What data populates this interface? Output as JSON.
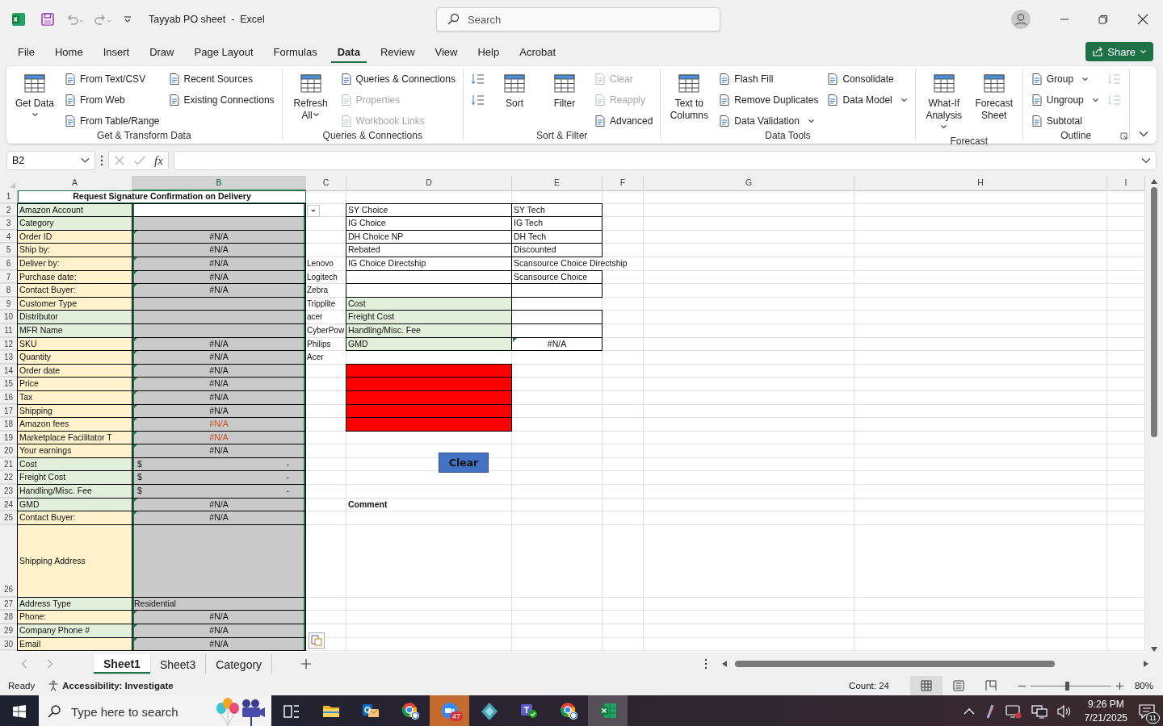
{
  "window": {
    "title": "Tayyab PO sheet  -  Excel",
    "search": {
      "placeholder": "Search"
    }
  },
  "menu": {
    "tabs": [
      {
        "label": "File",
        "selected": false
      },
      {
        "label": "Home",
        "selected": false
      },
      {
        "label": "Insert",
        "selected": false
      },
      {
        "label": "Draw",
        "selected": false
      },
      {
        "label": "Page Layout",
        "selected": false
      },
      {
        "label": "Formulas",
        "selected": false
      },
      {
        "label": "Data",
        "selected": true
      },
      {
        "label": "Review",
        "selected": false
      },
      {
        "label": "View",
        "selected": false
      },
      {
        "label": "Help",
        "selected": false
      },
      {
        "label": "Acrobat",
        "selected": false
      }
    ],
    "share": "Share"
  },
  "ribbon": {
    "groups": [
      {
        "label": "Get & Transform Data",
        "launcher": false,
        "items": [
          {
            "kind": "large",
            "label": "Get Data",
            "dropdown": true,
            "disabled": false
          },
          {
            "kind": "small",
            "label": "From Text/CSV",
            "dropdown": false,
            "disabled": false
          },
          {
            "kind": "small",
            "label": "From Web",
            "dropdown": false,
            "disabled": false
          },
          {
            "kind": "small",
            "label": "From Table/Range",
            "dropdown": false,
            "disabled": false
          },
          {
            "kind": "small",
            "label": "Recent Sources",
            "dropdown": false,
            "disabled": false
          },
          {
            "kind": "small",
            "label": "Existing Connections",
            "dropdown": false,
            "disabled": false
          }
        ]
      },
      {
        "label": "Queries & Connections",
        "launcher": false,
        "items": [
          {
            "kind": "large",
            "label": "Refresh All",
            "dropdown": true,
            "disabled": false
          },
          {
            "kind": "small",
            "label": "Queries & Connections",
            "dropdown": false,
            "disabled": false
          },
          {
            "kind": "small",
            "label": "Properties",
            "dropdown": false,
            "disabled": true
          },
          {
            "kind": "small",
            "label": "Workbook Links",
            "dropdown": false,
            "disabled": true
          }
        ]
      },
      {
        "label": "Sort & Filter",
        "launcher": false,
        "items": [
          {
            "kind": "icon",
            "dropdown": false,
            "disabled": false
          },
          {
            "kind": "icon",
            "dropdown": false,
            "disabled": false
          },
          {
            "kind": "large",
            "label": "Sort",
            "dropdown": false,
            "disabled": false
          },
          {
            "kind": "large",
            "label": "Filter",
            "dropdown": false,
            "disabled": false
          },
          {
            "kind": "small",
            "label": "Clear",
            "dropdown": false,
            "disabled": true
          },
          {
            "kind": "small",
            "label": "Reapply",
            "dropdown": false,
            "disabled": true
          },
          {
            "kind": "small",
            "label": "Advanced",
            "dropdown": false,
            "disabled": false
          }
        ]
      },
      {
        "label": "Data Tools",
        "launcher": false,
        "items": [
          {
            "kind": "large",
            "label": "Text to Columns",
            "dropdown": false,
            "disabled": false
          },
          {
            "kind": "small",
            "label": "Flash Fill",
            "dropdown": false,
            "disabled": false
          },
          {
            "kind": "small",
            "label": "Remove Duplicates",
            "dropdown": false,
            "disabled": false
          },
          {
            "kind": "small",
            "label": "Data Validation",
            "dropdown": true,
            "disabled": false
          },
          {
            "kind": "small",
            "label": "Consolidate",
            "dropdown": false,
            "disabled": false
          },
          {
            "kind": "small",
            "label": "Data Model",
            "dropdown": true,
            "disabled": false
          }
        ]
      },
      {
        "label": "Forecast",
        "launcher": false,
        "items": [
          {
            "kind": "large",
            "label": "What-If Analysis",
            "dropdown": true,
            "disabled": false
          },
          {
            "kind": "large",
            "label": "Forecast Sheet",
            "dropdown": false,
            "disabled": false
          }
        ]
      },
      {
        "label": "Outline",
        "launcher": true,
        "items": [
          {
            "kind": "small",
            "label": "Group",
            "dropdown": true,
            "disabled": false
          },
          {
            "kind": "small",
            "label": "Ungroup",
            "dropdown": true,
            "disabled": false
          },
          {
            "kind": "small",
            "label": "Subtotal",
            "dropdown": false,
            "disabled": false
          },
          {
            "kind": "icon",
            "dropdown": false,
            "disabled": true
          },
          {
            "kind": "icon",
            "dropdown": false,
            "disabled": true
          }
        ]
      }
    ]
  },
  "formula_bar": {
    "name_box": "B2",
    "function_label": "fx"
  },
  "sheet": {
    "columns": [
      {
        "label": "A",
        "selected": false
      },
      {
        "label": "B",
        "selected": true
      },
      {
        "label": "C",
        "selected": false
      },
      {
        "label": "D",
        "selected": false
      },
      {
        "label": "E",
        "selected": false
      },
      {
        "label": "F",
        "selected": false
      },
      {
        "label": "G",
        "selected": false
      },
      {
        "label": "H",
        "selected": false
      },
      {
        "label": "I",
        "selected": false
      }
    ],
    "rows": [
      {
        "number": "1",
        "kind": "normal",
        "cells": {
          "A": {
            "kind": "title",
            "text": "Request Signature Confirmation on Delivery",
            "flag": false,
            "boxed": false
          }
        }
      },
      {
        "number": "2",
        "kind": "normal",
        "cells": {
          "A": {
            "text": "Amazon Account",
            "color": "#e2efda",
            "flag": false,
            "boxed": true
          },
          "B": {
            "flag": false,
            "boxed": true
          },
          "D": {
            "text": "SY Choice",
            "flag": false,
            "boxed": true
          },
          "E": {
            "text": "SY Tech",
            "flag": false,
            "boxed": true
          }
        }
      },
      {
        "number": "3",
        "kind": "normal",
        "cells": {
          "A": {
            "text": "Category",
            "color": "#e2efda",
            "flag": false,
            "boxed": true
          },
          "B": {
            "color": "#c9c9c9",
            "flag": false,
            "boxed": true
          },
          "D": {
            "text": "IG Choice",
            "flag": false,
            "boxed": true
          },
          "E": {
            "text": "IG Tech",
            "flag": false,
            "boxed": true
          }
        }
      },
      {
        "number": "4",
        "kind": "normal",
        "cells": {
          "A": {
            "text": "Order ID",
            "color": "#fff2cc",
            "flag": false,
            "boxed": true
          },
          "B": {
            "kind": "value",
            "text": "#N/A",
            "color": "#c9c9c9",
            "flag": true,
            "boxed": true
          },
          "D": {
            "text": "DH Choice NP",
            "flag": false,
            "boxed": true
          },
          "E": {
            "text": "DH Tech",
            "flag": false,
            "boxed": true
          }
        }
      },
      {
        "number": "5",
        "kind": "normal",
        "cells": {
          "A": {
            "text": "Ship by:",
            "color": "#fff2cc",
            "flag": false,
            "boxed": true
          },
          "B": {
            "kind": "value",
            "text": "#N/A",
            "color": "#c9c9c9",
            "flag": false,
            "boxed": true
          },
          "D": {
            "text": "Rebated",
            "flag": false,
            "boxed": true
          },
          "E": {
            "text": "Discounted",
            "flag": false,
            "boxed": true
          }
        }
      },
      {
        "number": "6",
        "kind": "normal",
        "cells": {
          "A": {
            "text": "Deliver by:",
            "color": "#fff2cc",
            "flag": false,
            "boxed": true
          },
          "B": {
            "kind": "value",
            "text": "#N/A",
            "color": "#c9c9c9",
            "flag": true,
            "boxed": true
          },
          "C": {
            "text": "Lenovo",
            "flag": false,
            "boxed": false
          },
          "D": {
            "text": "IG Choice Directship",
            "flag": false,
            "boxed": true
          },
          "E": {
            "kind": "spill",
            "text": "Scansource Choice Directship",
            "flag": false,
            "boxed": false
          }
        }
      },
      {
        "number": "7",
        "kind": "normal",
        "cells": {
          "A": {
            "text": "Purchase date:",
            "color": "#fff2cc",
            "flag": false,
            "boxed": true
          },
          "B": {
            "kind": "value",
            "text": "#N/A",
            "color": "#c9c9c9",
            "flag": true,
            "boxed": true
          },
          "C": {
            "text": "Logitech",
            "flag": false,
            "boxed": false
          },
          "D": {
            "flag": false,
            "boxed": true
          },
          "E": {
            "text": "Scansource Choice",
            "flag": false,
            "boxed": true
          }
        }
      },
      {
        "number": "8",
        "kind": "normal",
        "cells": {
          "A": {
            "text": "Contact Buyer:",
            "color": "#fff2cc",
            "flag": false,
            "boxed": true
          },
          "B": {
            "kind": "value",
            "text": "#N/A",
            "color": "#c9c9c9",
            "flag": true,
            "boxed": true
          },
          "C": {
            "text": "Zebra",
            "flag": false,
            "boxed": false
          },
          "D": {
            "flag": false,
            "boxed": true
          },
          "E": {
            "flag": false,
            "boxed": true
          }
        }
      },
      {
        "number": "9",
        "kind": "normal",
        "cells": {
          "A": {
            "text": "Customer Type",
            "color": "#fff2cc",
            "flag": false,
            "boxed": true
          },
          "B": {
            "color": "#c9c9c9",
            "flag": false,
            "boxed": true
          },
          "C": {
            "text": "Tripplite",
            "flag": false,
            "boxed": false
          },
          "D": {
            "text": "Cost",
            "color": "#e2efda",
            "flag": false,
            "boxed": true
          }
        }
      },
      {
        "number": "10",
        "kind": "normal",
        "cells": {
          "A": {
            "text": "Distributor",
            "color": "#e2efda",
            "flag": false,
            "boxed": true
          },
          "B": {
            "color": "#c9c9c9",
            "flag": false,
            "boxed": true
          },
          "C": {
            "text": "acer",
            "flag": false,
            "boxed": false
          },
          "D": {
            "text": "Freight Cost",
            "color": "#e2efda",
            "flag": false,
            "boxed": true
          },
          "E": {
            "flag": false,
            "boxed": true
          }
        }
      },
      {
        "number": "11",
        "kind": "normal",
        "cells": {
          "A": {
            "text": "MFR Name",
            "color": "#e2efda",
            "flag": false,
            "boxed": true
          },
          "B": {
            "color": "#c9c9c9",
            "flag": false,
            "boxed": true
          },
          "C": {
            "text": "CyberPow",
            "flag": false,
            "boxed": false
          },
          "D": {
            "text": "Handling/Misc. Fee",
            "color": "#e2efda",
            "flag": false,
            "boxed": true
          },
          "E": {
            "flag": false,
            "boxed": true
          }
        }
      },
      {
        "number": "12",
        "kind": "normal",
        "cells": {
          "A": {
            "text": "SKU",
            "color": "#fff2cc",
            "flag": false,
            "boxed": true
          },
          "B": {
            "kind": "value",
            "text": "#N/A",
            "color": "#c9c9c9",
            "flag": true,
            "boxed": true
          },
          "C": {
            "text": "Philips",
            "flag": false,
            "boxed": false
          },
          "D": {
            "text": "GMD",
            "color": "#e2efda",
            "flag": false,
            "boxed": true
          },
          "E": {
            "kind": "value",
            "text": "#N/A",
            "flag": true,
            "boxed": true
          }
        }
      },
      {
        "number": "13",
        "kind": "normal",
        "cells": {
          "A": {
            "text": "Quantity",
            "color": "#fff2cc",
            "flag": false,
            "boxed": true
          },
          "B": {
            "kind": "value",
            "text": "#N/A",
            "color": "#c9c9c9",
            "flag": true,
            "boxed": true
          },
          "C": {
            "text": "Acer",
            "flag": false,
            "boxed": false
          }
        }
      },
      {
        "number": "14",
        "kind": "normal",
        "cells": {
          "A": {
            "text": "Order date",
            "color": "#fff2cc",
            "flag": false,
            "boxed": true
          },
          "B": {
            "kind": "value",
            "text": "#N/A",
            "color": "#c9c9c9",
            "flag": true,
            "boxed": true
          },
          "D": {
            "color": "#ff0000",
            "flag": false,
            "boxed": true
          }
        }
      },
      {
        "number": "15",
        "kind": "normal",
        "cells": {
          "A": {
            "text": "Price",
            "color": "#fff2cc",
            "flag": false,
            "boxed": true
          },
          "B": {
            "kind": "value",
            "text": "#N/A",
            "color": "#c9c9c9",
            "flag": true,
            "boxed": true
          },
          "D": {
            "color": "#ff0000",
            "flag": false,
            "boxed": true
          }
        }
      },
      {
        "number": "16",
        "kind": "normal",
        "cells": {
          "A": {
            "text": "Tax",
            "color": "#fff2cc",
            "flag": false,
            "boxed": true
          },
          "B": {
            "kind": "value",
            "text": "#N/A",
            "color": "#c9c9c9",
            "flag": true,
            "boxed": true
          },
          "D": {
            "color": "#ff0000",
            "flag": false,
            "boxed": true
          }
        }
      },
      {
        "number": "17",
        "kind": "normal",
        "cells": {
          "A": {
            "text": "Shipping",
            "color": "#fff2cc",
            "flag": false,
            "boxed": true
          },
          "B": {
            "kind": "value",
            "text": "#N/A",
            "color": "#c9c9c9",
            "flag": true,
            "boxed": true
          },
          "D": {
            "color": "#ff0000",
            "flag": false,
            "boxed": true
          }
        }
      },
      {
        "number": "18",
        "kind": "normal",
        "cells": {
          "A": {
            "text": "Amazon fees",
            "color": "#fff2cc",
            "flag": false,
            "boxed": true
          },
          "B": {
            "kind": "error",
            "text": "#N/A",
            "color": "#c9c9c9",
            "flag": true,
            "boxed": true
          },
          "D": {
            "color": "#ff0000",
            "flag": false,
            "boxed": true
          }
        }
      },
      {
        "number": "19",
        "kind": "normal",
        "cells": {
          "A": {
            "text": "Marketplace Facilitator T",
            "color": "#fff2cc",
            "flag": false,
            "boxed": true
          },
          "B": {
            "kind": "error",
            "text": "#N/A",
            "color": "#c9c9c9",
            "flag": true,
            "boxed": true
          }
        }
      },
      {
        "number": "20",
        "kind": "normal",
        "cells": {
          "A": {
            "text": "Your earnings",
            "color": "#fff2cc",
            "flag": false,
            "boxed": true
          },
          "B": {
            "kind": "value",
            "text": "#N/A",
            "color": "#c9c9c9",
            "flag": true,
            "boxed": true
          }
        }
      },
      {
        "number": "21",
        "kind": "normal",
        "cells": {
          "A": {
            "text": "Cost",
            "color": "#e2efda",
            "flag": false,
            "boxed": true
          },
          "B": {
            "kind": "accounting",
            "text": "$",
            "amount": "-",
            "color": "#c9c9c9",
            "flag": false,
            "boxed": true
          }
        }
      },
      {
        "number": "22",
        "kind": "normal",
        "cells": {
          "A": {
            "text": "Freight Cost",
            "color": "#e2efda",
            "flag": false,
            "boxed": true
          },
          "B": {
            "kind": "accounting",
            "text": "$",
            "amount": "-",
            "color": "#c9c9c9",
            "flag": false,
            "boxed": true
          }
        }
      },
      {
        "number": "23",
        "kind": "normal",
        "cells": {
          "A": {
            "text": "Handling/Misc. Fee",
            "color": "#e2efda",
            "flag": false,
            "boxed": true
          },
          "B": {
            "kind": "accounting",
            "text": "$",
            "amount": "-",
            "color": "#c9c9c9",
            "flag": false,
            "boxed": true
          }
        }
      },
      {
        "number": "24",
        "kind": "normal",
        "cells": {
          "A": {
            "text": "GMD",
            "color": "#e2efda",
            "flag": false,
            "boxed": true
          },
          "B": {
            "kind": "value",
            "text": "#N/A",
            "color": "#c9c9c9",
            "flag": true,
            "boxed": true
          },
          "D": {
            "kind": "note",
            "text": "Comment",
            "flag": false,
            "boxed": false
          }
        }
      },
      {
        "number": "25",
        "kind": "normal",
        "cells": {
          "A": {
            "text": "Contact Buyer:",
            "color": "#fff2cc",
            "flag": false,
            "boxed": true
          },
          "B": {
            "kind": "value",
            "text": "#N/A",
            "color": "#c9c9c9",
            "flag": true,
            "boxed": true
          }
        }
      },
      {
        "number": "26",
        "kind": "tall",
        "cells": {
          "A": {
            "text": "Shipping Address",
            "color": "#fff2cc",
            "flag": false,
            "boxed": true
          },
          "B": {
            "color": "#c9c9c9",
            "flag": false,
            "boxed": true
          }
        }
      },
      {
        "number": "27",
        "kind": "normal",
        "cells": {
          "A": {
            "text": "Address Type",
            "color": "#e2efda",
            "flag": false,
            "boxed": true
          },
          "B": {
            "text": "Residential",
            "color": "#c9c9c9",
            "flag": false,
            "boxed": true
          }
        }
      },
      {
        "number": "28",
        "kind": "normal",
        "cells": {
          "A": {
            "text": "Phone:",
            "color": "#fff2cc",
            "flag": false,
            "boxed": true
          },
          "B": {
            "kind": "value",
            "text": "#N/A",
            "color": "#c9c9c9",
            "flag": true,
            "boxed": true
          }
        }
      },
      {
        "number": "29",
        "kind": "normal",
        "cells": {
          "A": {
            "text": "Company Phone #",
            "color": "#e2efda",
            "flag": false,
            "boxed": true
          },
          "B": {
            "kind": "value",
            "text": "#N/A",
            "color": "#c9c9c9",
            "flag": true,
            "boxed": true
          }
        }
      },
      {
        "number": "30",
        "kind": "normal",
        "cells": {
          "A": {
            "text": "Email",
            "color": "#fff2cc",
            "flag": false,
            "boxed": true
          },
          "B": {
            "kind": "value",
            "text": "#N/A",
            "color": "#c9c9c9",
            "flag": true,
            "boxed": true
          }
        }
      }
    ],
    "buttons": [
      {
        "label": "Clear"
      }
    ]
  },
  "sheet_tabs": {
    "tabs": [
      {
        "label": "Sheet1",
        "selected": true
      },
      {
        "label": "Sheet3",
        "selected": false
      },
      {
        "label": "Category",
        "selected": false
      }
    ]
  },
  "status_bar": {
    "mode": "Ready",
    "accessibility": "Accessibility: Investigate",
    "count": "Count: 24",
    "views": [
      {
        "kind": "normal",
        "selected": true
      },
      {
        "kind": "page_layout",
        "selected": false
      },
      {
        "kind": "page_break",
        "selected": false
      }
    ],
    "zoom": {
      "level": 0.45,
      "label": "80%"
    }
  },
  "taskbar": {
    "search": {
      "placeholder": "Type here to search"
    },
    "apps": [
      {
        "kind": "taskview",
        "running": false,
        "selected": false,
        "attention": false
      },
      {
        "kind": "folder",
        "running": true,
        "selected": false,
        "attention": false
      },
      {
        "kind": "mail",
        "running": true,
        "selected": false,
        "attention": false
      },
      {
        "kind": "browser",
        "running": true,
        "selected": false,
        "attention": false
      },
      {
        "kind": "video",
        "running": true,
        "selected": false,
        "attention": true,
        "badge": "47"
      },
      {
        "kind": "diamond",
        "running": false,
        "selected": false,
        "attention": false
      },
      {
        "kind": "chat",
        "running": true,
        "selected": false,
        "attention": false
      },
      {
        "kind": "browser",
        "running": true,
        "selected": false,
        "attention": false
      },
      {
        "kind": "spreadsheet",
        "running": true,
        "selected": true,
        "attention": false
      }
    ],
    "time": "9:26 PM",
    "date": "7/21/2025",
    "notifications": "11"
  }
}
